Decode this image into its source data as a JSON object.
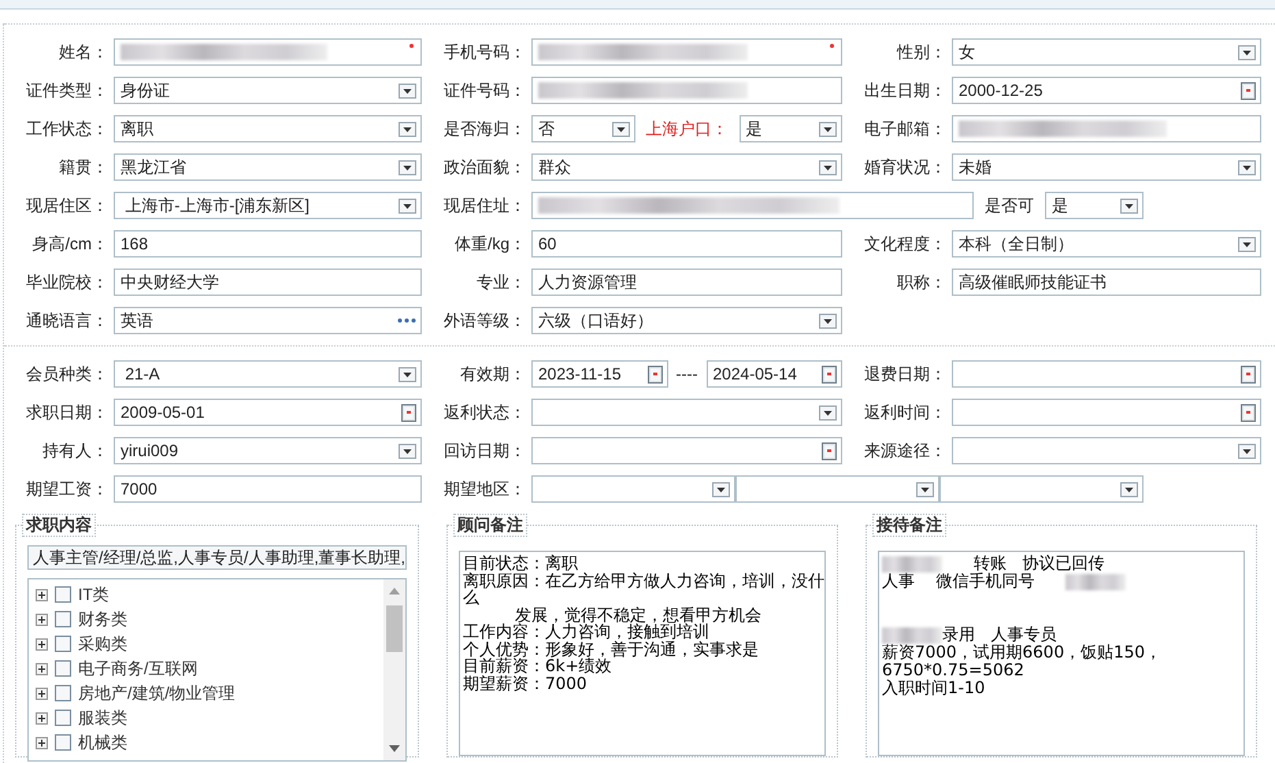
{
  "personal_section": {
    "rows": [
      {
        "groups": [
          {
            "label": "姓名：",
            "parts": [
              {
                "kind": "text",
                "redacted": true,
                "required": true
              }
            ]
          },
          {
            "label": "手机号码：",
            "parts": [
              {
                "kind": "text",
                "redacted": true,
                "required": true
              }
            ]
          },
          {
            "label": "性别：",
            "parts": [
              {
                "kind": "select",
                "value": "女"
              }
            ]
          }
        ]
      },
      {
        "groups": [
          {
            "label": "证件类型：",
            "parts": [
              {
                "kind": "select",
                "value": "身份证"
              }
            ]
          },
          {
            "label": "证件号码：",
            "parts": [
              {
                "kind": "text",
                "redacted": true
              }
            ]
          },
          {
            "label": "出生日期：",
            "parts": [
              {
                "kind": "date",
                "value": "2000-12-25"
              }
            ]
          }
        ]
      },
      {
        "groups": [
          {
            "label": "工作状态：",
            "parts": [
              {
                "kind": "select",
                "value": "离职"
              }
            ]
          },
          {
            "label": "是否海归：",
            "parts": [
              {
                "kind": "select",
                "value": "否"
              },
              {
                "kind": "label",
                "text": "上海户口：",
                "emphasis": true
              },
              {
                "kind": "select",
                "value": "是"
              }
            ]
          },
          {
            "label": "电子邮箱：",
            "parts": [
              {
                "kind": "text",
                "redacted": true
              }
            ]
          }
        ]
      },
      {
        "groups": [
          {
            "label": "籍贯：",
            "parts": [
              {
                "kind": "select",
                "value": "黑龙江省"
              }
            ]
          },
          {
            "label": "政治面貌：",
            "parts": [
              {
                "kind": "select",
                "value": "群众"
              }
            ]
          },
          {
            "label": "婚育状况：",
            "parts": [
              {
                "kind": "select",
                "value": "未婚"
              }
            ]
          }
        ]
      },
      {
        "groups": [
          {
            "label": "现居住区：",
            "parts": [
              {
                "kind": "select",
                "value": " 上海市-上海市-[浦东新区]"
              }
            ]
          },
          {
            "label": "现居住址：",
            "parts": [
              {
                "kind": "text",
                "redacted": true
              },
              {
                "kind": "label",
                "text": "是否可"
              },
              {
                "kind": "select",
                "value": "是"
              }
            ]
          }
        ]
      },
      {
        "groups": [
          {
            "label": "身高/cm：",
            "parts": [
              {
                "kind": "text",
                "value": "168"
              }
            ]
          },
          {
            "label": "体重/kg：",
            "parts": [
              {
                "kind": "text",
                "value": "60"
              }
            ]
          },
          {
            "label": "文化程度：",
            "parts": [
              {
                "kind": "select",
                "value": "本科（全日制）"
              }
            ]
          }
        ]
      },
      {
        "groups": [
          {
            "label": "毕业院校：",
            "parts": [
              {
                "kind": "text",
                "value": "中央财经大学"
              }
            ]
          },
          {
            "label": "专业：",
            "parts": [
              {
                "kind": "text",
                "value": "人力资源管理"
              }
            ]
          },
          {
            "label": "职称：",
            "parts": [
              {
                "kind": "text",
                "value": "高级催眠师技能证书"
              }
            ]
          }
        ]
      },
      {
        "groups": [
          {
            "label": "通晓语言：",
            "parts": [
              {
                "kind": "lookup",
                "value": "英语"
              }
            ]
          },
          {
            "label": "外语等级：",
            "parts": [
              {
                "kind": "select",
                "value": "六级（口语好）"
              }
            ]
          }
        ]
      }
    ]
  },
  "membership_section": {
    "rows": [
      {
        "groups": [
          {
            "label": "会员种类：",
            "parts": [
              {
                "kind": "select",
                "value": " 21-A"
              }
            ]
          },
          {
            "label": "有效期：",
            "parts": [
              {
                "kind": "date",
                "value": "2023-11-15"
              },
              {
                "kind": "separator",
                "text": "----"
              },
              {
                "kind": "date",
                "value": "2024-05-14"
              }
            ]
          },
          {
            "label": "退费日期：",
            "parts": [
              {
                "kind": "date"
              }
            ]
          }
        ]
      },
      {
        "groups": [
          {
            "label": "求职日期：",
            "parts": [
              {
                "kind": "date",
                "value": "2009-05-01"
              }
            ]
          },
          {
            "label": "返利状态：",
            "parts": [
              {
                "kind": "select"
              }
            ]
          },
          {
            "label": "返利时间：",
            "parts": [
              {
                "kind": "date"
              }
            ]
          }
        ]
      },
      {
        "groups": [
          {
            "label": "持有人：",
            "parts": [
              {
                "kind": "select",
                "value": "yirui009"
              }
            ]
          },
          {
            "label": "回访日期：",
            "parts": [
              {
                "kind": "date"
              }
            ]
          },
          {
            "label": "来源途径：",
            "parts": [
              {
                "kind": "select"
              }
            ]
          }
        ]
      },
      {
        "groups": [
          {
            "label": "期望工资：",
            "parts": [
              {
                "kind": "text",
                "value": "7000"
              }
            ]
          },
          {
            "label": "期望地区：",
            "parts": [
              {
                "kind": "select"
              },
              {
                "kind": "select"
              },
              {
                "kind": "select"
              }
            ]
          }
        ]
      }
    ]
  },
  "job_panel": {
    "title": "求职内容",
    "selection": "人事主管/经理/总监,人事专员/人事助理,董事长助理,",
    "tree": [
      {
        "label": "IT类",
        "checked": false,
        "expanded": false
      },
      {
        "label": "财务类",
        "checked": false,
        "expanded": false
      },
      {
        "label": "采购类",
        "checked": false,
        "expanded": false
      },
      {
        "label": "电子商务/互联网",
        "checked": false,
        "expanded": false
      },
      {
        "label": "房地产/建筑/物业管理",
        "checked": false,
        "expanded": false
      },
      {
        "label": "服装类",
        "checked": false,
        "expanded": false
      },
      {
        "label": "机械类",
        "checked": false,
        "expanded": false
      }
    ]
  },
  "advisor_panel": {
    "title": "顾问备注",
    "lines": [
      "目前状态：离职",
      "离职原因：在乙方给甲方做人力咨询，培训，没什",
      "么",
      "          发展，觉得不稳定，想看甲方机会",
      "工作内容：人力咨询，接触到培训",
      "个人优势：形象好，善于沟通，实事求是",
      "目前薪资：6k+绩效",
      "期望薪资：7000"
    ]
  },
  "reception_panel": {
    "title": "接待备注",
    "lines": [
      {
        "segments": [
          {
            "kind": "redacted"
          },
          {
            "kind": "text",
            "text": "      转账   协议已回传"
          }
        ]
      },
      {
        "segments": [
          {
            "kind": "text",
            "text": "人事    微信手机同号      "
          },
          {
            "kind": "redacted"
          }
        ]
      },
      {
        "segments": [
          {
            "kind": "blank"
          }
        ]
      },
      {
        "segments": [
          {
            "kind": "blank"
          }
        ]
      },
      {
        "segments": [
          {
            "kind": "redacted"
          },
          {
            "kind": "text",
            "text": "录用   人事专员"
          }
        ]
      },
      {
        "segments": [
          {
            "kind": "text",
            "text": "薪资7000，试用期6600，饭贴150，"
          }
        ]
      },
      {
        "segments": [
          {
            "kind": "text",
            "text": "6750*0.75=5062"
          }
        ]
      },
      {
        "segments": [
          {
            "kind": "text",
            "text": "入职时间1-10"
          }
        ]
      }
    ]
  }
}
